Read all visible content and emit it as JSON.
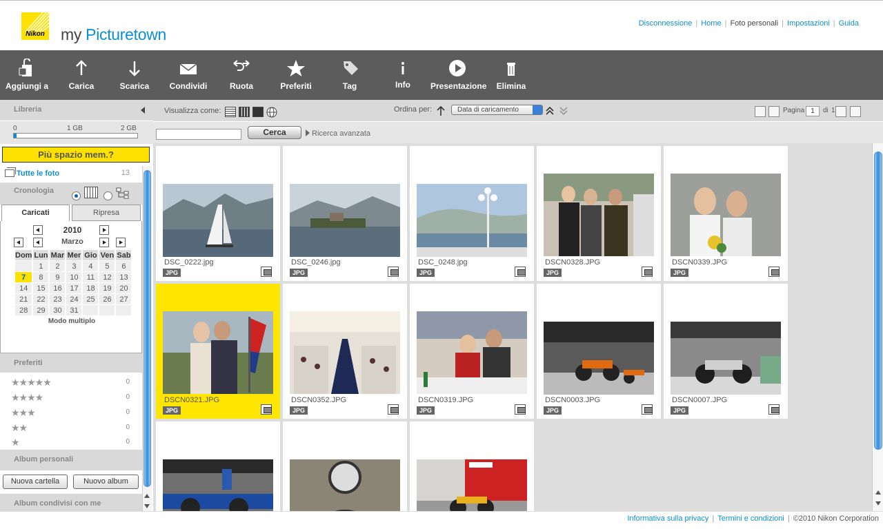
{
  "header": {
    "brand_prefix": "my ",
    "brand_bold": "Picture",
    "brand_suffix": "town",
    "logo_text": "Nikon",
    "links": [
      {
        "label": "Disconnessione",
        "link": true
      },
      {
        "label": "Home",
        "link": true
      },
      {
        "label": "Foto personali",
        "link": false
      },
      {
        "label": "Impostazioni",
        "link": true
      },
      {
        "label": "Guida",
        "link": true
      }
    ]
  },
  "toolbar": {
    "items": [
      {
        "label": "Aggiungi a",
        "icon": "add-to-icon"
      },
      {
        "label": "Carica",
        "icon": "upload-arrow-icon"
      },
      {
        "label": "Scarica",
        "icon": "download-arrow-icon"
      },
      {
        "label": "Condividi",
        "icon": "envelope-icon"
      },
      {
        "label": "Ruota",
        "icon": "rotate-icon"
      },
      {
        "label": "Preferiti",
        "icon": "star-icon"
      },
      {
        "label": "Tag",
        "icon": "tag-icon"
      },
      {
        "label": "Info",
        "icon": "info-icon"
      },
      {
        "label": "Presentazione",
        "icon": "play-icon"
      },
      {
        "label": "Elimina",
        "icon": "trash-icon"
      }
    ]
  },
  "library": {
    "title": "Libreria",
    "storage": {
      "labels": [
        "0",
        "1 GB",
        "2 GB"
      ],
      "used_fraction": 0.02
    },
    "more_space": "Più spazio mem.?",
    "all_photos": {
      "label": "Tutte le foto",
      "count": "13"
    },
    "cronologia": "Cronologia",
    "tabs": [
      "Caricati",
      "Ripresa"
    ],
    "calendar": {
      "year": "2010",
      "month": "Marzo",
      "weekdays": [
        "Dom",
        "Lun",
        "Mar",
        "Mer",
        "Gio",
        "Ven",
        "Sab"
      ],
      "weeks": [
        [
          "",
          "1",
          "2",
          "3",
          "4",
          "5",
          "6"
        ],
        [
          "7",
          "8",
          "9",
          "10",
          "11",
          "12",
          "13"
        ],
        [
          "14",
          "15",
          "16",
          "17",
          "18",
          "19",
          "20"
        ],
        [
          "21",
          "22",
          "23",
          "24",
          "25",
          "26",
          "27"
        ],
        [
          "28",
          "29",
          "30",
          "31",
          "",
          "",
          ""
        ]
      ],
      "today": "7",
      "multi_mode": "Modo multiplo"
    },
    "favorites": {
      "title": "Preferiti",
      "rows": [
        {
          "stars": "★★★★★",
          "count": "0"
        },
        {
          "stars": "★★★★",
          "count": "0"
        },
        {
          "stars": "★★★",
          "count": "0"
        },
        {
          "stars": "★★",
          "count": "0"
        },
        {
          "stars": "★",
          "count": "0"
        }
      ]
    },
    "personal_albums": "Album personali",
    "new_folder": "Nuova cartella",
    "new_album": "Nuovo album",
    "shared_albums": "Album condivisi con me"
  },
  "viewbar": {
    "view_as": "Visualizza come:",
    "sort_by": "Ordina per:",
    "sort_value": "Data di caricamento",
    "page_label": "Pagina",
    "page": "1",
    "of_label": "di",
    "total_pages": "1"
  },
  "search": {
    "button": "Cerca",
    "placeholder": "",
    "advanced": "Ricerca avanzata"
  },
  "photos": [
    {
      "name": "DSC_0222.jpg",
      "badge": "JPG",
      "selected": false,
      "scene": "sailboat-lake"
    },
    {
      "name": "DSC_0246.jpg",
      "badge": "JPG",
      "selected": false,
      "scene": "island-lake"
    },
    {
      "name": "DSC_0248.jpg",
      "badge": "JPG",
      "selected": false,
      "scene": "lamppost-lake"
    },
    {
      "name": "DSCN0328.JPG",
      "badge": "JPG",
      "selected": false,
      "scene": "group-women"
    },
    {
      "name": "DSCN0339.JPG",
      "badge": "JPG",
      "selected": false,
      "scene": "bride-friend"
    },
    {
      "name": "DSCN0321.JPG",
      "badge": "JPG",
      "selected": true,
      "scene": "couple-flag"
    },
    {
      "name": "DSCN0352.JPG",
      "badge": "JPG",
      "selected": false,
      "scene": "banquet-hall"
    },
    {
      "name": "DSCN0319.JPG",
      "badge": "JPG",
      "selected": false,
      "scene": "party-table"
    },
    {
      "name": "DSCN0003.JPG",
      "badge": "JPG",
      "selected": false,
      "scene": "motorbike-show"
    },
    {
      "name": "DSCN0007.JPG",
      "badge": "JPG",
      "selected": false,
      "scene": "motorbike-show-2"
    },
    {
      "name": "",
      "badge": "",
      "selected": false,
      "scene": "suzuki-bike"
    },
    {
      "name": "",
      "badge": "",
      "selected": false,
      "scene": "gauge-closeup"
    },
    {
      "name": "",
      "badge": "",
      "selected": false,
      "scene": "expo-stand"
    }
  ],
  "footer": {
    "privacy": "Informativa sulla privacy",
    "terms": "Termini e condizioni",
    "copyright": "©2010 Nikon Corporation"
  },
  "colors": {
    "accent": "#0b8fd4",
    "toolbar": "#5c5c5c",
    "highlight": "#ffe100"
  }
}
